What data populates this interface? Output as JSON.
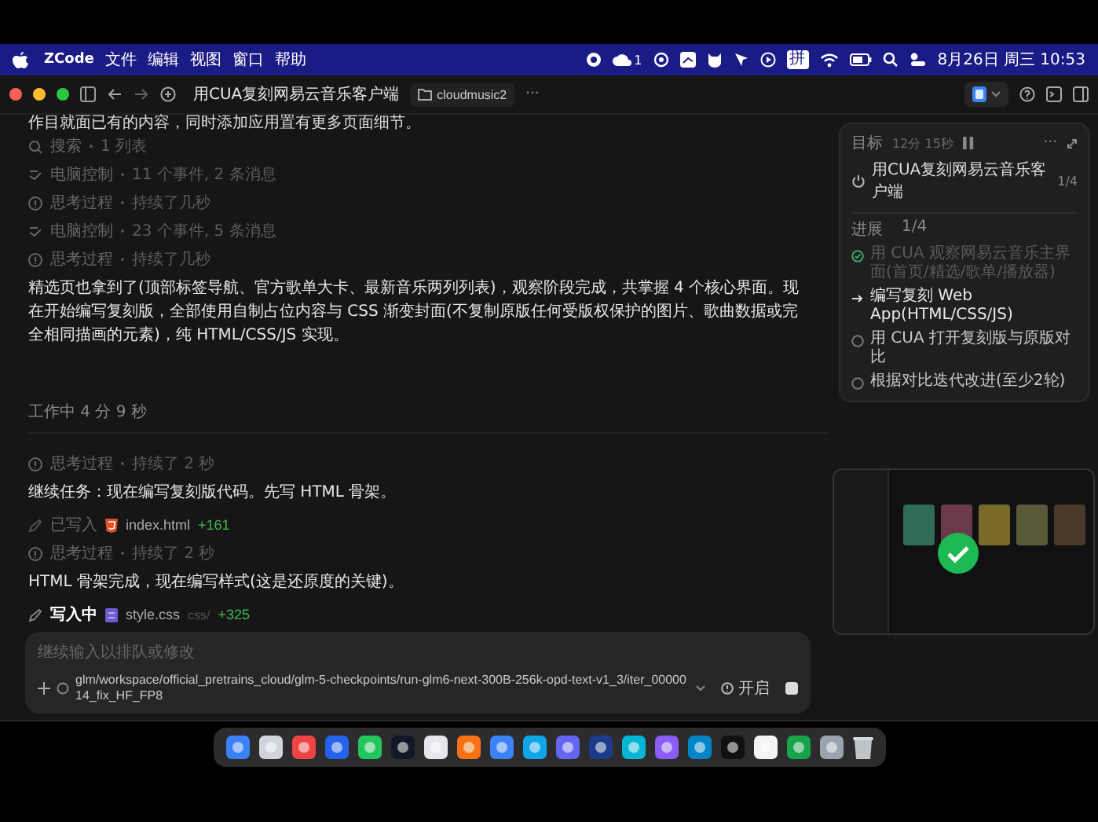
{
  "menubar": {
    "app": "ZCode",
    "menus": [
      "文件",
      "编辑",
      "视图",
      "窗口",
      "帮助"
    ],
    "badge_count": "1",
    "input_method": "拼",
    "datetime": "8月26日 周三 10:53"
  },
  "window": {
    "title": "用CUA复刻网易云音乐客户端",
    "folder": "cloudmusic2",
    "more": "···"
  },
  "transcript": [
    {
      "kind": "text",
      "text": "作目就面已有的内容，同时添加应用置有更多页面细节。"
    },
    {
      "kind": "search",
      "label": "搜索",
      "detail": "1 列表"
    },
    {
      "kind": "computer_control",
      "label": "电脑控制",
      "detail": "11 个事件, 2 条消息"
    },
    {
      "kind": "thinking",
      "label": "思考过程",
      "detail": "持续了几秒"
    },
    {
      "kind": "computer_control",
      "label": "电脑控制",
      "detail": "23 个事件, 5 条消息"
    },
    {
      "kind": "thinking",
      "label": "思考过程",
      "detail": "持续了几秒"
    },
    {
      "kind": "text",
      "text": "精选页也拿到了(顶部标签导航、官方歌单大卡、最新音乐两列列表)，观察阶段完成，共掌握 4 个核心界面。现在开始编写复刻版，全部使用自制占位内容与 CSS 渐变封面(不复制原版任何受版权保护的图片、歌曲数据或完全相同描画的元素)，纯 HTML/CSS/JS 实现。"
    },
    {
      "kind": "status",
      "text": "工作中 4 分 9 秒"
    },
    {
      "kind": "thinking",
      "label": "思考过程",
      "detail": "持续了 2 秒"
    },
    {
      "kind": "text",
      "text": "继续任务：现在编写复刻版代码。先写 HTML 骨架。"
    },
    {
      "kind": "html_file",
      "label": "已写入",
      "name": "index.html",
      "added": "+161",
      "active": false
    },
    {
      "kind": "thinking",
      "label": "思考过程",
      "detail": "持续了 2 秒"
    },
    {
      "kind": "text",
      "text": "HTML 骨架完成，现在编写样式(这是还原度的关键)。"
    },
    {
      "kind": "css_file",
      "label": "写入中",
      "name": "style.css",
      "path": "css/",
      "added": "+325",
      "active": true
    }
  ],
  "goal_panel": {
    "title": "目标",
    "elapsed": "12分 15秒",
    "goal": "用CUA复刻网易云音乐客户端",
    "goal_count": "1/4",
    "progress_label": "进展",
    "progress_count": "1/4",
    "tasks": [
      {
        "text": "用 CUA 观察网易云音乐主界面(首页/精选/歌单/播放器)",
        "done": true,
        "current": false
      },
      {
        "text": "编写复刻 Web App(HTML/CSS/JS)",
        "done": false,
        "current": true
      },
      {
        "text": "用 CUA 打开复刻版与原版对比",
        "done": false,
        "current": false
      },
      {
        "text": "根据对比迭代改进(至少2轮)",
        "done": false,
        "current": false
      }
    ]
  },
  "composer": {
    "placeholder": "继续输入以排队或修改",
    "model": "glm/workspace/official_pretrains_cloud/glm-5-checkpoints/run-glm6-next-300B-256k-opd-text-v1_3/iter_0000014_fix_HF_FP8",
    "mode": "开启"
  }
}
